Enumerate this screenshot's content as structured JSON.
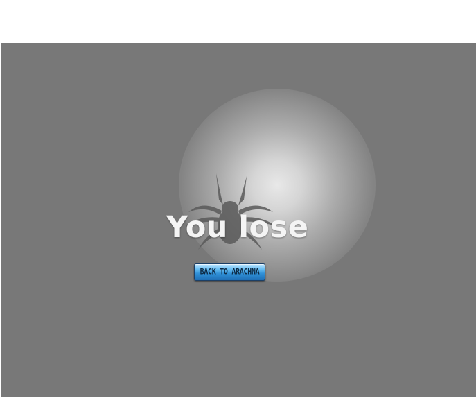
{
  "game": {
    "result_text": "You lose",
    "back_button_label": "BACK TO ARACHNA",
    "emblem_icon": "spider-icon"
  },
  "colors": {
    "stage_background": "#787878",
    "glow_center": "#e8e8e8",
    "title_text": "#f4f4f4",
    "button_top": "#bfe6ff",
    "button_bottom": "#1f6fb6",
    "button_text": "#0d2a45",
    "spider_silhouette": "#5a5a5a"
  }
}
